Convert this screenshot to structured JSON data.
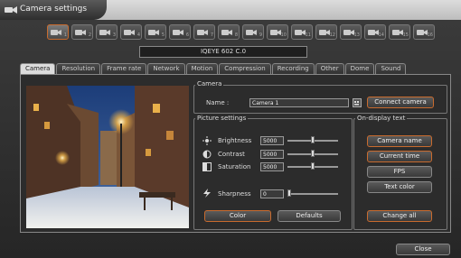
{
  "window": {
    "title": "Camera settings"
  },
  "camera_selector": [
    {
      "num": "1",
      "active": true
    },
    {
      "num": "2"
    },
    {
      "num": "3"
    },
    {
      "num": "4"
    },
    {
      "num": "5"
    },
    {
      "num": "6"
    },
    {
      "num": "7"
    },
    {
      "num": "8"
    },
    {
      "num": "9"
    },
    {
      "num": "10"
    },
    {
      "num": "11"
    },
    {
      "num": "12"
    },
    {
      "num": "13"
    },
    {
      "num": "14"
    },
    {
      "num": "15"
    },
    {
      "num": "16"
    }
  ],
  "model": "IQEYE 602 C.0",
  "tabs": [
    "Camera",
    "Resolution",
    "Frame rate",
    "Network",
    "Motion",
    "Compression",
    "Recording",
    "Other",
    "Dome",
    "Sound"
  ],
  "active_tab": "Camera",
  "camera_group": {
    "title": "Camera",
    "name_label": "Name :",
    "name_value": "Camera 1",
    "connect_label": "Connect camera"
  },
  "picture_settings": {
    "title": "Picture settings",
    "brightness": {
      "label": "Brightness",
      "value": "5000",
      "level": 0.5
    },
    "contrast": {
      "label": "Contrast",
      "value": "5000",
      "level": 0.5
    },
    "saturation": {
      "label": "Saturation",
      "value": "5000",
      "level": 0.5
    },
    "sharpness": {
      "label": "Sharpness",
      "value": "0",
      "level": 0
    },
    "color_label": "Color",
    "defaults_label": "Defaults"
  },
  "on_display_text": {
    "title": "On-display text",
    "buttons": [
      "Camera name",
      "Current time",
      "FPS",
      "Text color"
    ],
    "change_all_label": "Change all"
  },
  "close_label": "Close",
  "colors": {
    "accent": "#c96b2e",
    "background": "#2a2a2a"
  }
}
